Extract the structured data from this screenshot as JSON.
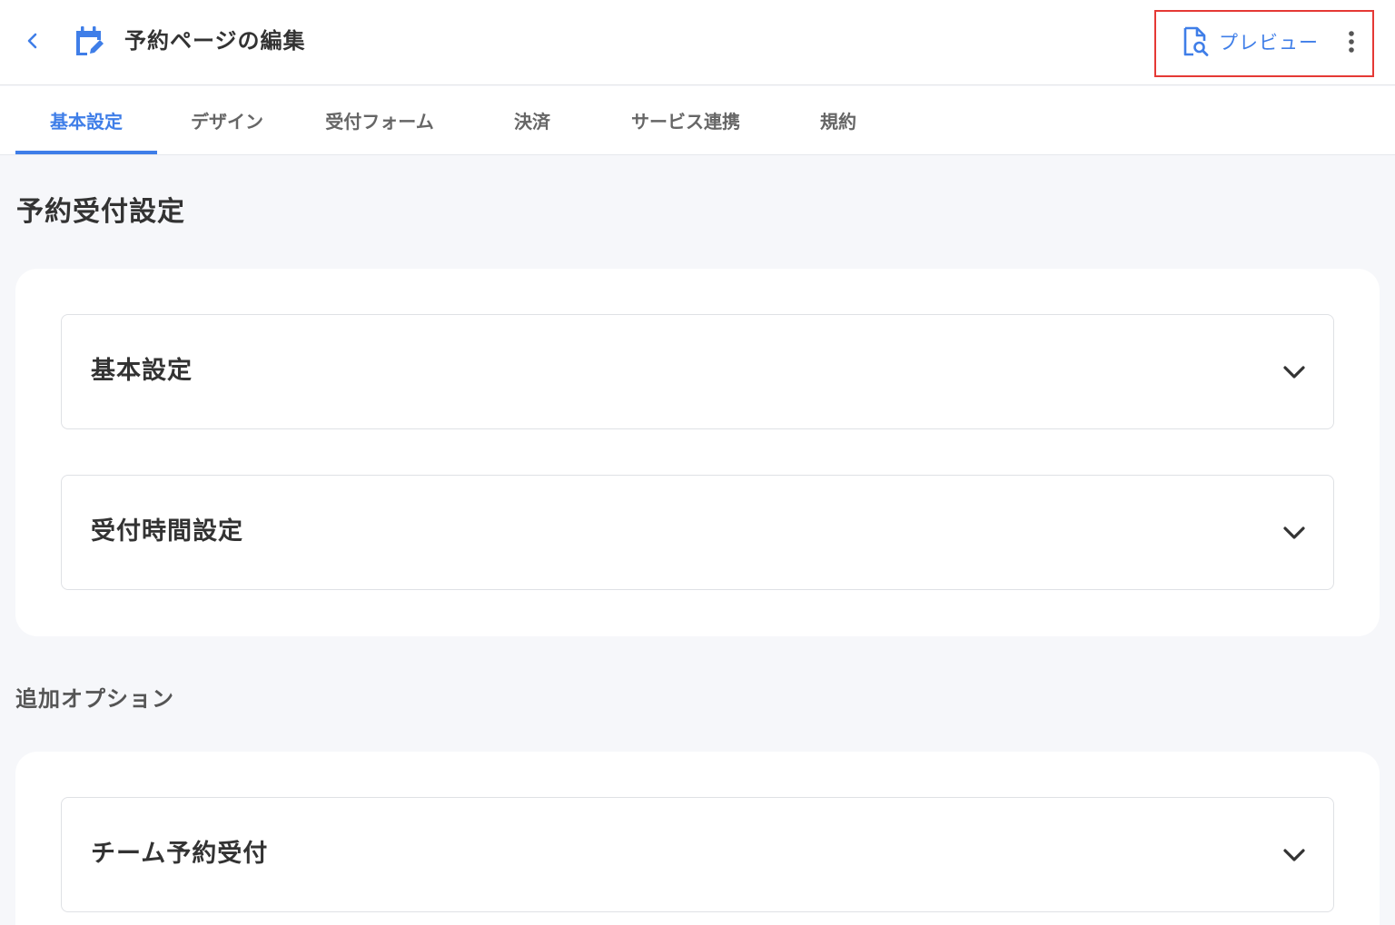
{
  "header": {
    "title": "予約ページの編集",
    "preview_label": "プレビュー",
    "accent_color": "#3f7ee8",
    "highlight_color": "#e53935"
  },
  "tabs": [
    {
      "label": "基本設定",
      "active": true
    },
    {
      "label": "デザイン",
      "active": false
    },
    {
      "label": "受付フォーム",
      "active": false
    },
    {
      "label": "決済",
      "active": false
    },
    {
      "label": "サービス連携",
      "active": false
    },
    {
      "label": "規約",
      "active": false
    }
  ],
  "main": {
    "section_title": "予約受付設定",
    "section_items": [
      {
        "label": "基本設定"
      },
      {
        "label": "受付時間設定"
      }
    ],
    "options_title": "追加オプション",
    "options_items": [
      {
        "label": "チーム予約受付"
      }
    ]
  }
}
